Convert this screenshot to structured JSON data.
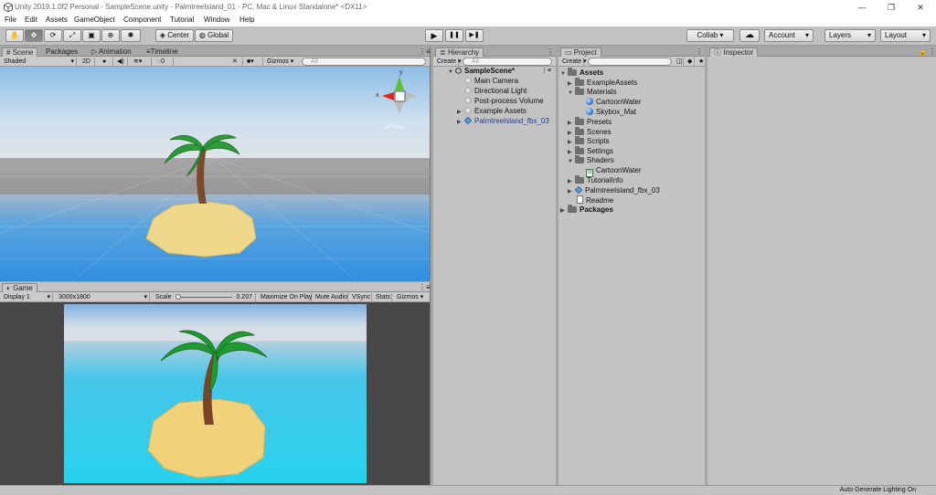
{
  "window": {
    "title": "Unity 2019.1.0f2 Personal - SampleScene.unity - PalmtreeIsland_01 - PC, Mac & Linux Standalone* <DX11>",
    "minimize": "—",
    "maximize": "❐",
    "close": "✕"
  },
  "menu": [
    "File",
    "Edit",
    "Assets",
    "GameObject",
    "Component",
    "Tutorial",
    "Window",
    "Help"
  ],
  "toolbar": {
    "tools": [
      "hand-icon",
      "move-icon",
      "rotate-icon",
      "scale-icon",
      "rect-icon",
      "transform-icon",
      "custom-tool-icon"
    ],
    "tool_glyphs": [
      "✋",
      "✥",
      "⟳",
      "⤢",
      "▣",
      "⊕",
      "✱"
    ],
    "center_label": "Center",
    "global_label": "Global",
    "play": "▶",
    "pause": "❚❚",
    "step": "▶❚",
    "collab_label": "Collab ▾",
    "cloud": "☁",
    "account_label": "Account",
    "layers_label": "Layers",
    "layout_label": "Layout",
    "dropdown_arrow": "▾"
  },
  "scene_panel": {
    "tabs": [
      "Scene",
      "Packages",
      "Animation",
      "Timeline"
    ],
    "shading_mode": "Shaded",
    "mode_2d": "2D",
    "gizmos_label": "Gizmos",
    "search_placeholder": "All",
    "hidden_count": "0",
    "persp_label": "≤Persp",
    "axis_y": "y",
    "axis_x": "x"
  },
  "game_panel": {
    "tab": "Game",
    "display": "Display 1",
    "resolution": "3000x1800",
    "scale_label": "Scale",
    "scale_value": "0.207",
    "maximize_on_play": "Maximize On Play",
    "mute_audio": "Mute Audio",
    "vsync": "VSync",
    "stats": "Stats",
    "gizmos": "Gizmos"
  },
  "hierarchy": {
    "tab": "Hierarchy",
    "create_label": "Create",
    "search_placeholder": "All",
    "scene_name": "SampleScene*",
    "items": [
      "Main Camera",
      "Directional Light",
      "Post-process Volume",
      "Example Assets",
      "PalmtreeIsland_fbx_03"
    ]
  },
  "project": {
    "tab": "Project",
    "create_label": "Create",
    "tree": [
      {
        "label": "Assets",
        "icon": "folder",
        "bold": true
      },
      {
        "label": "ExampleAssets",
        "icon": "folder"
      },
      {
        "label": "Materials",
        "icon": "folder"
      },
      {
        "label": "CartoonWater",
        "icon": "material-sphere"
      },
      {
        "label": "Skybox_Mat",
        "icon": "material-sphere"
      },
      {
        "label": "Presets",
        "icon": "folder"
      },
      {
        "label": "Scenes",
        "icon": "folder"
      },
      {
        "label": "Scripts",
        "icon": "folder"
      },
      {
        "label": "Settings",
        "icon": "folder"
      },
      {
        "label": "Shaders",
        "icon": "folder"
      },
      {
        "label": "CartoonWater",
        "icon": "shader-script"
      },
      {
        "label": "TutorialInfo",
        "icon": "folder"
      },
      {
        "label": "PalmtreeIsland_fbx_03",
        "icon": "prefab-cube"
      },
      {
        "label": "Readme",
        "icon": "document"
      },
      {
        "label": "Packages",
        "icon": "folder",
        "bold": true
      }
    ]
  },
  "inspector": {
    "tab": "Inspector"
  },
  "status": {
    "text": "Auto Generate Lighting On"
  }
}
